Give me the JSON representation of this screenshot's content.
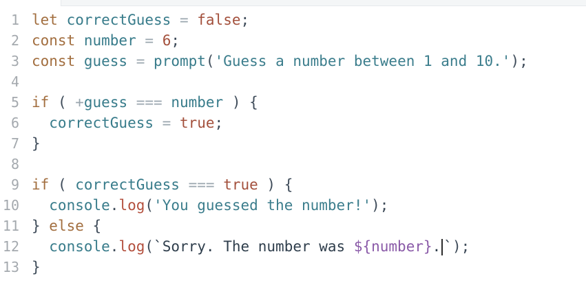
{
  "editor": {
    "line_numbers": [
      "1",
      "2",
      "3",
      "4",
      "5",
      "6",
      "7",
      "8",
      "9",
      "10",
      "11",
      "12",
      "13"
    ],
    "lines": [
      [
        {
          "t": "let",
          "c": "kw"
        },
        {
          "t": " correctGuess ",
          "c": "var"
        },
        {
          "t": "=",
          "c": "op"
        },
        {
          "t": " ",
          "c": "pn"
        },
        {
          "t": "false",
          "c": "num"
        },
        {
          "t": ";",
          "c": "pn"
        }
      ],
      [
        {
          "t": "const",
          "c": "kw"
        },
        {
          "t": " number ",
          "c": "var"
        },
        {
          "t": "=",
          "c": "op"
        },
        {
          "t": " ",
          "c": "pn"
        },
        {
          "t": "6",
          "c": "num"
        },
        {
          "t": ";",
          "c": "pn"
        }
      ],
      [
        {
          "t": "const",
          "c": "kw"
        },
        {
          "t": " guess ",
          "c": "var"
        },
        {
          "t": "=",
          "c": "op"
        },
        {
          "t": " prompt",
          "c": "fn"
        },
        {
          "t": "(",
          "c": "pn"
        },
        {
          "t": "'Guess a number between 1 and 10.'",
          "c": "str"
        },
        {
          "t": ");",
          "c": "pn"
        }
      ],
      [],
      [
        {
          "t": "if",
          "c": "kw"
        },
        {
          "t": " ( ",
          "c": "pn"
        },
        {
          "t": "+",
          "c": "op"
        },
        {
          "t": "guess ",
          "c": "var"
        },
        {
          "t": "===",
          "c": "op"
        },
        {
          "t": " number",
          "c": "var"
        },
        {
          "t": " ) {",
          "c": "pn"
        }
      ],
      [
        {
          "t": "  correctGuess ",
          "c": "var"
        },
        {
          "t": "=",
          "c": "op"
        },
        {
          "t": " ",
          "c": "pn"
        },
        {
          "t": "true",
          "c": "num"
        },
        {
          "t": ";",
          "c": "pn"
        }
      ],
      [
        {
          "t": "}",
          "c": "pn"
        }
      ],
      [],
      [
        {
          "t": "if",
          "c": "kw"
        },
        {
          "t": " ( ",
          "c": "pn"
        },
        {
          "t": "correctGuess ",
          "c": "var"
        },
        {
          "t": "===",
          "c": "op"
        },
        {
          "t": " ",
          "c": "pn"
        },
        {
          "t": "true",
          "c": "num"
        },
        {
          "t": " ) {",
          "c": "pn"
        }
      ],
      [
        {
          "t": "  console",
          "c": "fn"
        },
        {
          "t": ".",
          "c": "pn"
        },
        {
          "t": "log",
          "c": "meth"
        },
        {
          "t": "(",
          "c": "pn"
        },
        {
          "t": "'You guessed the number!'",
          "c": "str"
        },
        {
          "t": ");",
          "c": "pn"
        }
      ],
      [
        {
          "t": "}",
          "c": "pn"
        },
        {
          "t": " else ",
          "c": "kw"
        },
        {
          "t": "{",
          "c": "pn"
        }
      ],
      [
        {
          "t": "  console",
          "c": "fn"
        },
        {
          "t": ".",
          "c": "pn"
        },
        {
          "t": "log",
          "c": "meth"
        },
        {
          "t": "(",
          "c": "pn"
        },
        {
          "t": "`Sorry. The number was ",
          "c": "tpl"
        },
        {
          "t": "${number}",
          "c": "interp"
        },
        {
          "t": ".",
          "c": "tpl"
        },
        {
          "t": "|",
          "c": "caret"
        },
        {
          "t": "`",
          "c": "tpl"
        },
        {
          "t": ");",
          "c": "pn"
        }
      ],
      [
        {
          "t": "}",
          "c": "pn"
        }
      ]
    ]
  }
}
